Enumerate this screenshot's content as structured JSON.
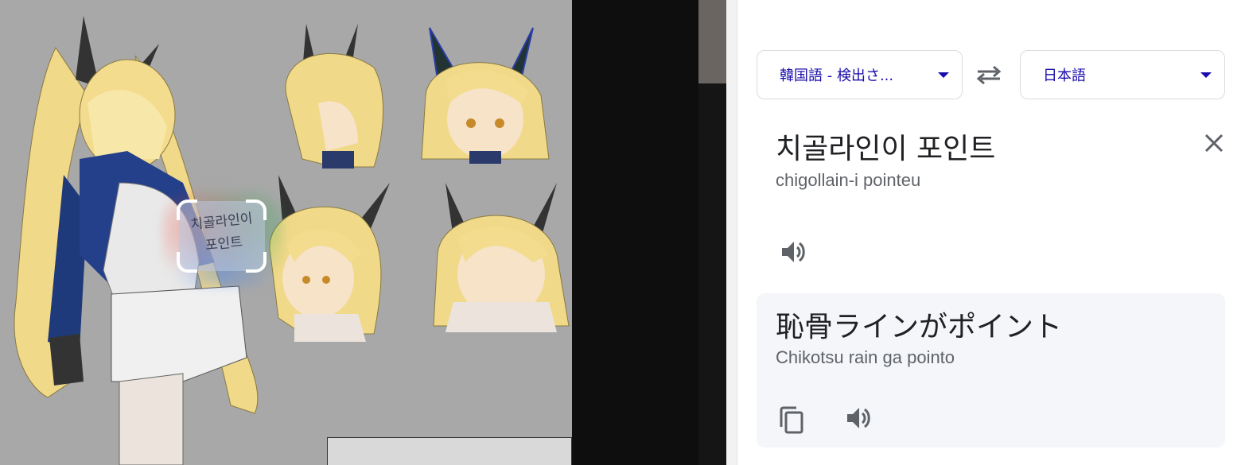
{
  "image_area": {
    "handwritten_note": "치골라인이\n포인트"
  },
  "translator": {
    "source_language": "韓国語 - 検出さ...",
    "target_language": "日本語",
    "source_text": "치골라인이 포인트",
    "source_romanization": "chigollain-i pointeu",
    "target_text": "恥骨ラインがポイント",
    "target_romanization": "Chikotsu rain ga pointo",
    "icons": {
      "swap": "swap-languages-icon",
      "clear": "close-icon",
      "speak": "volume-icon",
      "copy": "copy-icon",
      "dropdown": "chevron-down-icon"
    }
  },
  "colors": {
    "accent": "#1a0dab",
    "icon": "#5f6368",
    "result_background": "#f4f6f9",
    "sheet_background": "#a8a8a8"
  }
}
